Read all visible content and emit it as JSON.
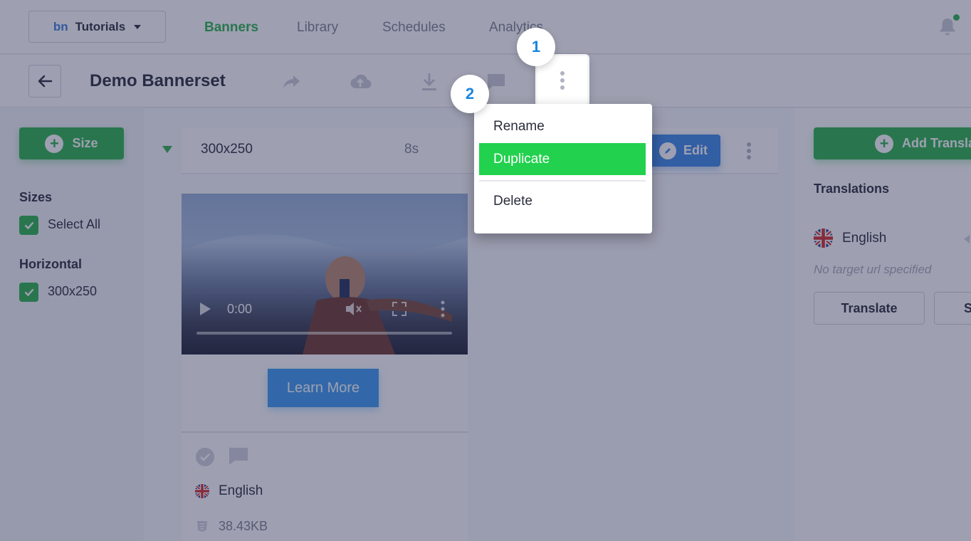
{
  "header": {
    "workspace_prefix": "bn",
    "workspace_name": "Tutorials",
    "tabs": [
      {
        "label": "Banners",
        "active": true
      },
      {
        "label": "Library",
        "active": false
      },
      {
        "label": "Schedules",
        "active": false
      },
      {
        "label": "Analytics",
        "active": false
      }
    ]
  },
  "toolbar": {
    "title": "Demo Bannerset",
    "icons": [
      "share-icon",
      "cloud-upload-icon",
      "download-icon",
      "comment-icon",
      "more-vertical-icon"
    ]
  },
  "sidebar": {
    "size_button": "Size",
    "sizes_heading": "Sizes",
    "select_all": "Select All",
    "group_heading": "Horizontal",
    "items": [
      {
        "label": "300x250",
        "checked": true
      }
    ]
  },
  "banner_row": {
    "size": "300x250",
    "duration": "8s",
    "edit_label": "Edit"
  },
  "preview": {
    "video_time": "0:00",
    "cta_label": "Learn More",
    "language": "English",
    "file_size": "38.43KB"
  },
  "context_menu": {
    "items": [
      {
        "label": "Rename",
        "highlighted": false
      },
      {
        "label": "Duplicate",
        "highlighted": true
      },
      {
        "label": "Delete",
        "highlighted": false
      }
    ]
  },
  "steps": [
    "1",
    "2"
  ],
  "translations": {
    "add_button": "Add Transla",
    "heading": "Translations",
    "language": "English",
    "note": "No target url specified",
    "translate_button": "Translate",
    "second_button": "S"
  },
  "colors": {
    "accent_green": "#2bb24c",
    "menu_highlight": "#22d14e",
    "edit_blue": "#3b87e8",
    "step_blue": "#1a86e0",
    "notification_dot": "#2bb24c"
  }
}
